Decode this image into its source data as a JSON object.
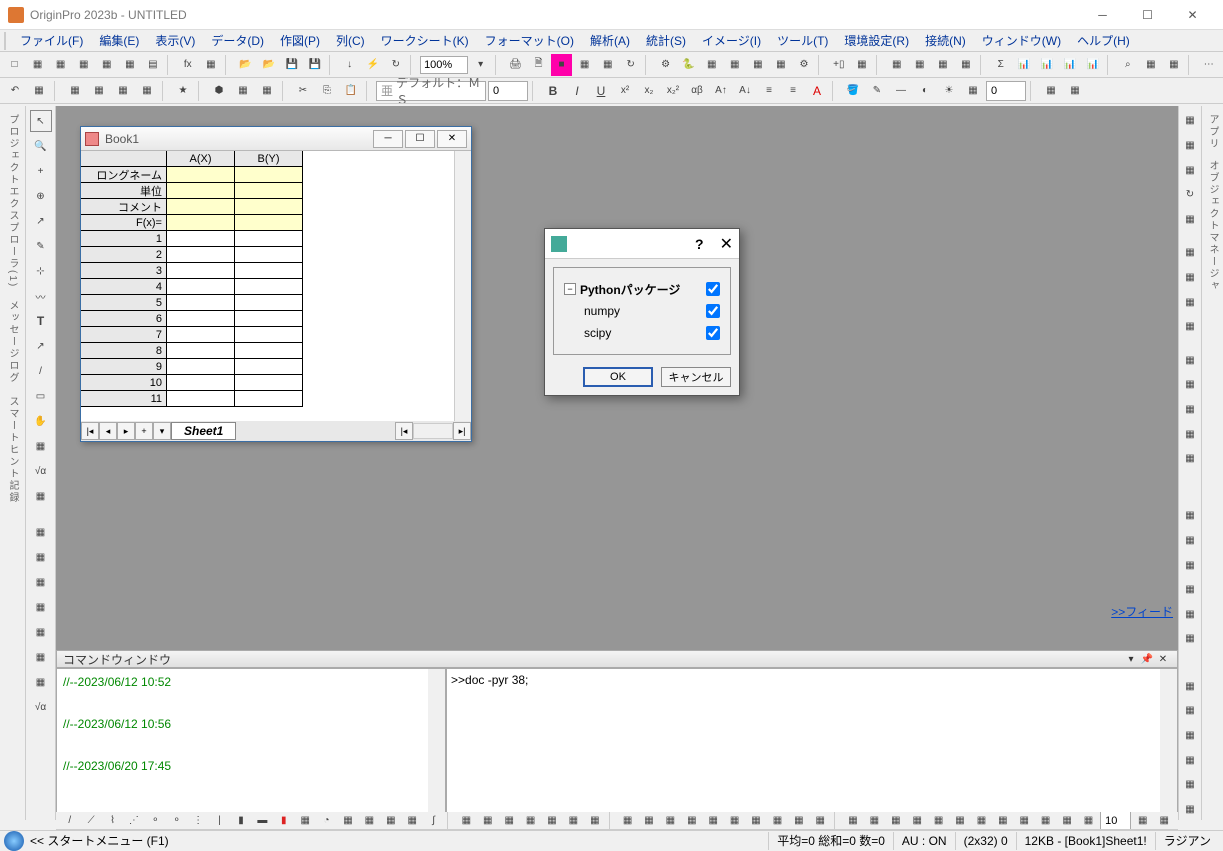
{
  "app": {
    "title": "OriginPro 2023b - UNTITLED"
  },
  "menu": [
    "ファイル(F)",
    "編集(E)",
    "表示(V)",
    "データ(D)",
    "作図(P)",
    "列(C)",
    "ワークシート(K)",
    "フォーマット(O)",
    "解析(A)",
    "統計(S)",
    "イメージ(I)",
    "ツール(T)",
    "環境設定(R)",
    "接続(N)",
    "ウィンドウ(W)",
    "ヘルプ(H)"
  ],
  "toolbar": {
    "zoom": "100%",
    "font": "デフォルト：ＭＳ",
    "fontsize": "0",
    "color_num": "0"
  },
  "book": {
    "title": "Book1",
    "cols": [
      "",
      "A(X)",
      "B(Y)"
    ],
    "rows": [
      "ロングネーム",
      "単位",
      "コメント",
      "F(x)=",
      "1",
      "2",
      "3",
      "4",
      "5",
      "6",
      "7",
      "8",
      "9",
      "10",
      "11"
    ],
    "tab": "Sheet1"
  },
  "dialog": {
    "group": "Pythonパッケージ",
    "items": [
      "numpy",
      "scipy"
    ],
    "ok": "OK",
    "cancel": "キャンセル"
  },
  "cmd": {
    "title": "コマンドウィンドウ",
    "history": [
      "//--2023/06/12 10:52",
      "",
      "",
      "//--2023/06/12 10:56",
      "",
      "",
      "//--2023/06/20 17:45"
    ],
    "prompt": ">>doc -pyr 38;"
  },
  "feed": ">>フィード",
  "status": {
    "start": "<< スタートメニュー (F1)",
    "stats": "平均=0 総和=0 数=0",
    "au": "AU : ON",
    "dim": "(2x32) 0",
    "size": "12KB - [Book1]Sheet1!",
    "angle": "ラジアン"
  },
  "graph_toolbar_num": "10"
}
